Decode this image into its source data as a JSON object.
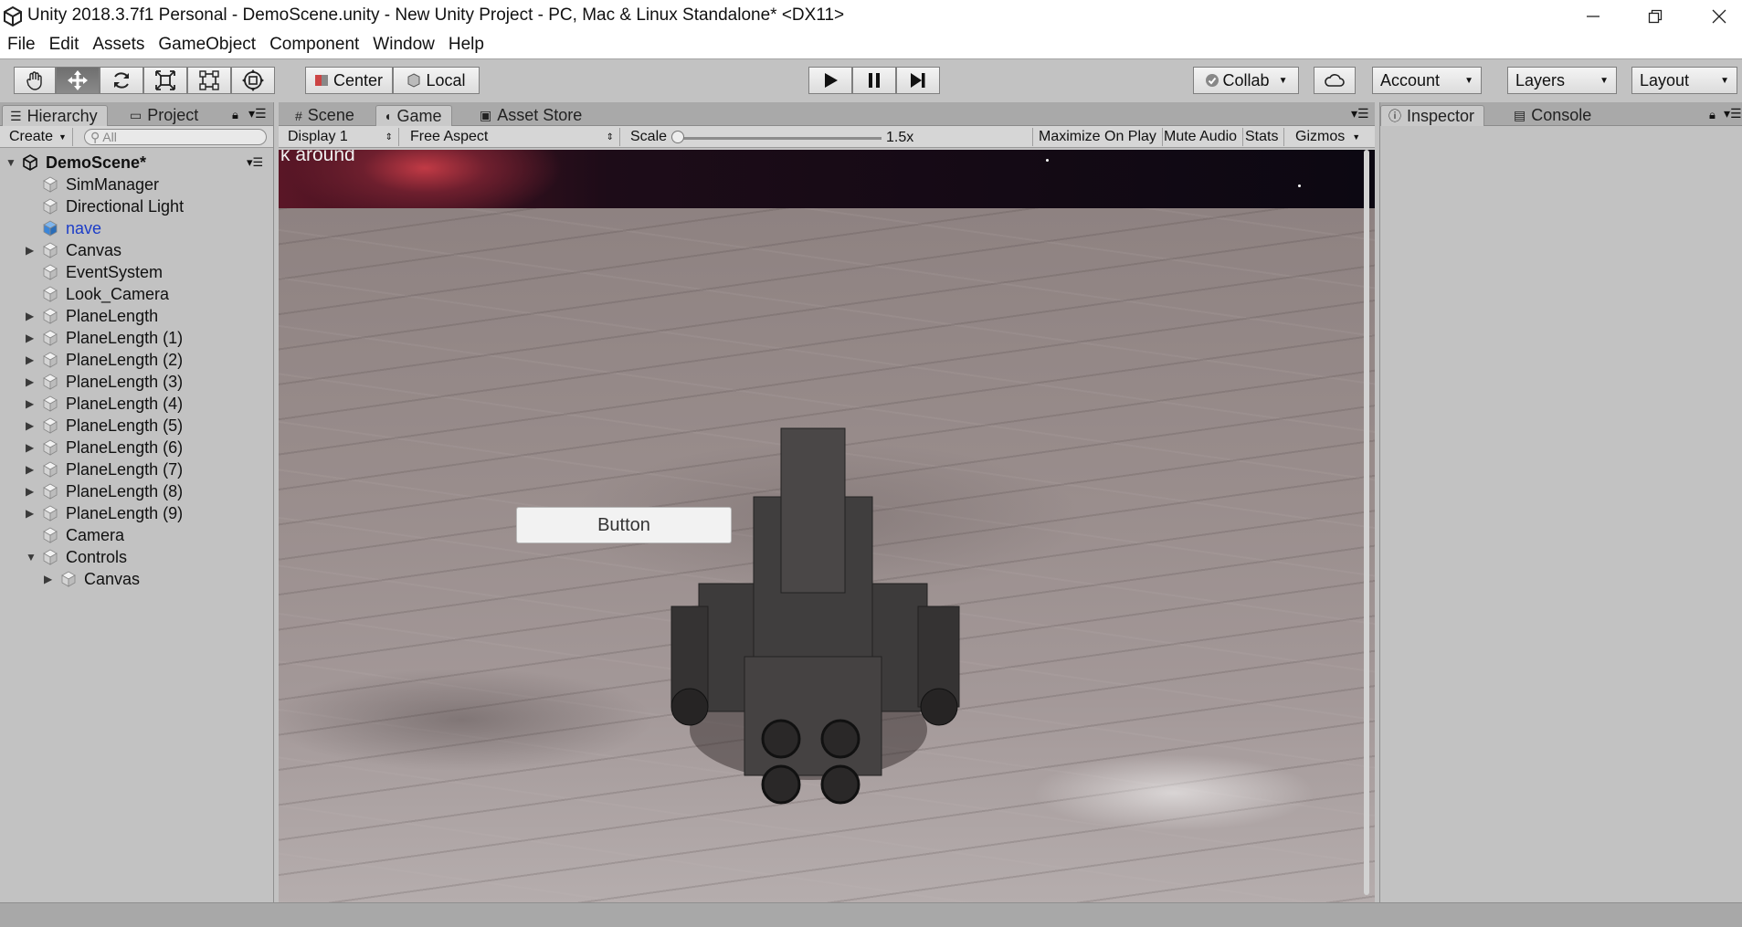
{
  "window": {
    "title": "Unity 2018.3.7f1 Personal - DemoScene.unity - New Unity Project - PC, Mac & Linux Standalone* <DX11>"
  },
  "menu": [
    "File",
    "Edit",
    "Assets",
    "GameObject",
    "Component",
    "Window",
    "Help"
  ],
  "toolbar": {
    "tools": [
      "hand-tool",
      "move-tool",
      "rotate-tool",
      "scale-tool",
      "rect-tool",
      "transform-tool"
    ],
    "active_tool": "move-tool",
    "pivot_label": "Center",
    "space_label": "Local",
    "collab_label": "Collab",
    "account_label": "Account",
    "layers_label": "Layers",
    "layout_label": "Layout"
  },
  "hierarchy": {
    "tab_hierarchy": "Hierarchy",
    "tab_project": "Project",
    "create_label": "Create",
    "search_placeholder": "All",
    "root": "DemoScene*",
    "items": [
      {
        "label": "SimManager",
        "expandable": false,
        "depth": 1
      },
      {
        "label": "Directional Light",
        "expandable": false,
        "depth": 1
      },
      {
        "label": "nave",
        "expandable": false,
        "depth": 1,
        "selected": true
      },
      {
        "label": "Canvas",
        "expandable": true,
        "depth": 1
      },
      {
        "label": "EventSystem",
        "expandable": false,
        "depth": 1
      },
      {
        "label": "Look_Camera",
        "expandable": false,
        "depth": 1
      },
      {
        "label": "PlaneLength",
        "expandable": true,
        "depth": 1
      },
      {
        "label": "PlaneLength (1)",
        "expandable": true,
        "depth": 1
      },
      {
        "label": "PlaneLength (2)",
        "expandable": true,
        "depth": 1
      },
      {
        "label": "PlaneLength (3)",
        "expandable": true,
        "depth": 1
      },
      {
        "label": "PlaneLength (4)",
        "expandable": true,
        "depth": 1
      },
      {
        "label": "PlaneLength (5)",
        "expandable": true,
        "depth": 1
      },
      {
        "label": "PlaneLength (6)",
        "expandable": true,
        "depth": 1
      },
      {
        "label": "PlaneLength (7)",
        "expandable": true,
        "depth": 1
      },
      {
        "label": "PlaneLength (8)",
        "expandable": true,
        "depth": 1
      },
      {
        "label": "PlaneLength (9)",
        "expandable": true,
        "depth": 1
      },
      {
        "label": "Camera",
        "expandable": false,
        "depth": 1
      },
      {
        "label": "Controls",
        "expandable": true,
        "expanded": true,
        "depth": 1
      },
      {
        "label": "Canvas",
        "expandable": true,
        "depth": 2
      }
    ]
  },
  "game": {
    "tab_scene": "Scene",
    "tab_game": "Game",
    "tab_asset_store": "Asset Store",
    "display": "Display 1",
    "aspect": "Free Aspect",
    "scale_label": "Scale",
    "scale_value": "1.5x",
    "maximize_on_play": "Maximize On Play",
    "mute_audio": "Mute Audio",
    "stats": "Stats",
    "gizmos": "Gizmos",
    "overlay_text": "k around",
    "ui_button_label": "Button"
  },
  "inspector": {
    "tab_inspector": "Inspector",
    "tab_console": "Console"
  },
  "colors": {
    "editor_bg": "#c2c2c2",
    "selection_text": "#1c3dc8"
  }
}
